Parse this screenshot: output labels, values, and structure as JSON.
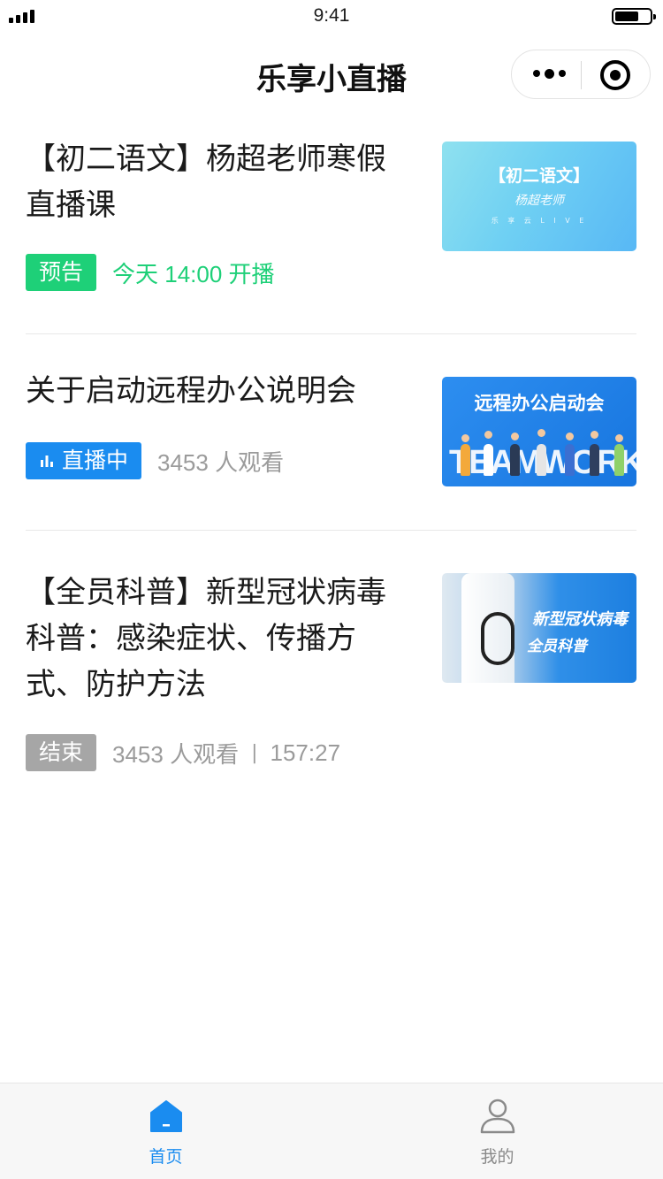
{
  "status_bar": {
    "time": "9:41"
  },
  "nav": {
    "title": "乐享小直播"
  },
  "items": [
    {
      "title": "【初二语文】杨超老师寒假直播课",
      "badge": "预告",
      "meta": "今天 14:00 开播",
      "thumb": {
        "line1": "【初二语文】",
        "line2": "杨超老师",
        "line3": "乐 享 云 L I V E"
      }
    },
    {
      "title": "关于启动远程办公说明会",
      "badge": "直播中",
      "meta": "3453 人观看",
      "thumb": {
        "line1": "远程办公启动会",
        "word": "TEAMWORK"
      }
    },
    {
      "title": "【全员科普】新型冠状病毒科普：感染症状、传播方式、防护方法",
      "badge": "结束",
      "meta": "3453 人观看",
      "meta_sep": "|",
      "duration": "157:27",
      "thumb": {
        "line1": "新型冠状病毒",
        "line2": "全员科普"
      }
    }
  ],
  "tabbar": {
    "home": "首页",
    "mine": "我的"
  },
  "colors": {
    "accent": "#1a8cf0",
    "preview_green": "#1ed078",
    "ended_gray": "#a6a6a6"
  }
}
